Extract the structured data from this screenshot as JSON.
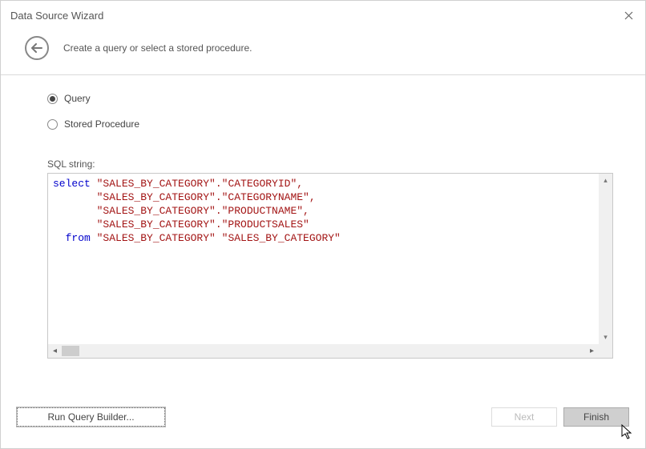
{
  "title": "Data Source Wizard",
  "header_instruction": "Create a query or select a stored procedure.",
  "radios": {
    "query": {
      "label": "Query",
      "checked": true
    },
    "stored_procedure": {
      "label": "Stored Procedure",
      "checked": false
    }
  },
  "sql_label": "SQL string:",
  "sql": {
    "kw_select": "select",
    "line1_rest": " \"SALES_BY_CATEGORY\".\"CATEGORYID\",",
    "line2": "       \"SALES_BY_CATEGORY\".\"CATEGORYNAME\",",
    "line3": "       \"SALES_BY_CATEGORY\".\"PRODUCTNAME\",",
    "line4": "       \"SALES_BY_CATEGORY\".\"PRODUCTSALES\"",
    "kw_from": "  from",
    "line5_rest": " \"SALES_BY_CATEGORY\" \"SALES_BY_CATEGORY\""
  },
  "buttons": {
    "run_query_builder": "Run Query Builder...",
    "next": "Next",
    "finish": "Finish"
  }
}
